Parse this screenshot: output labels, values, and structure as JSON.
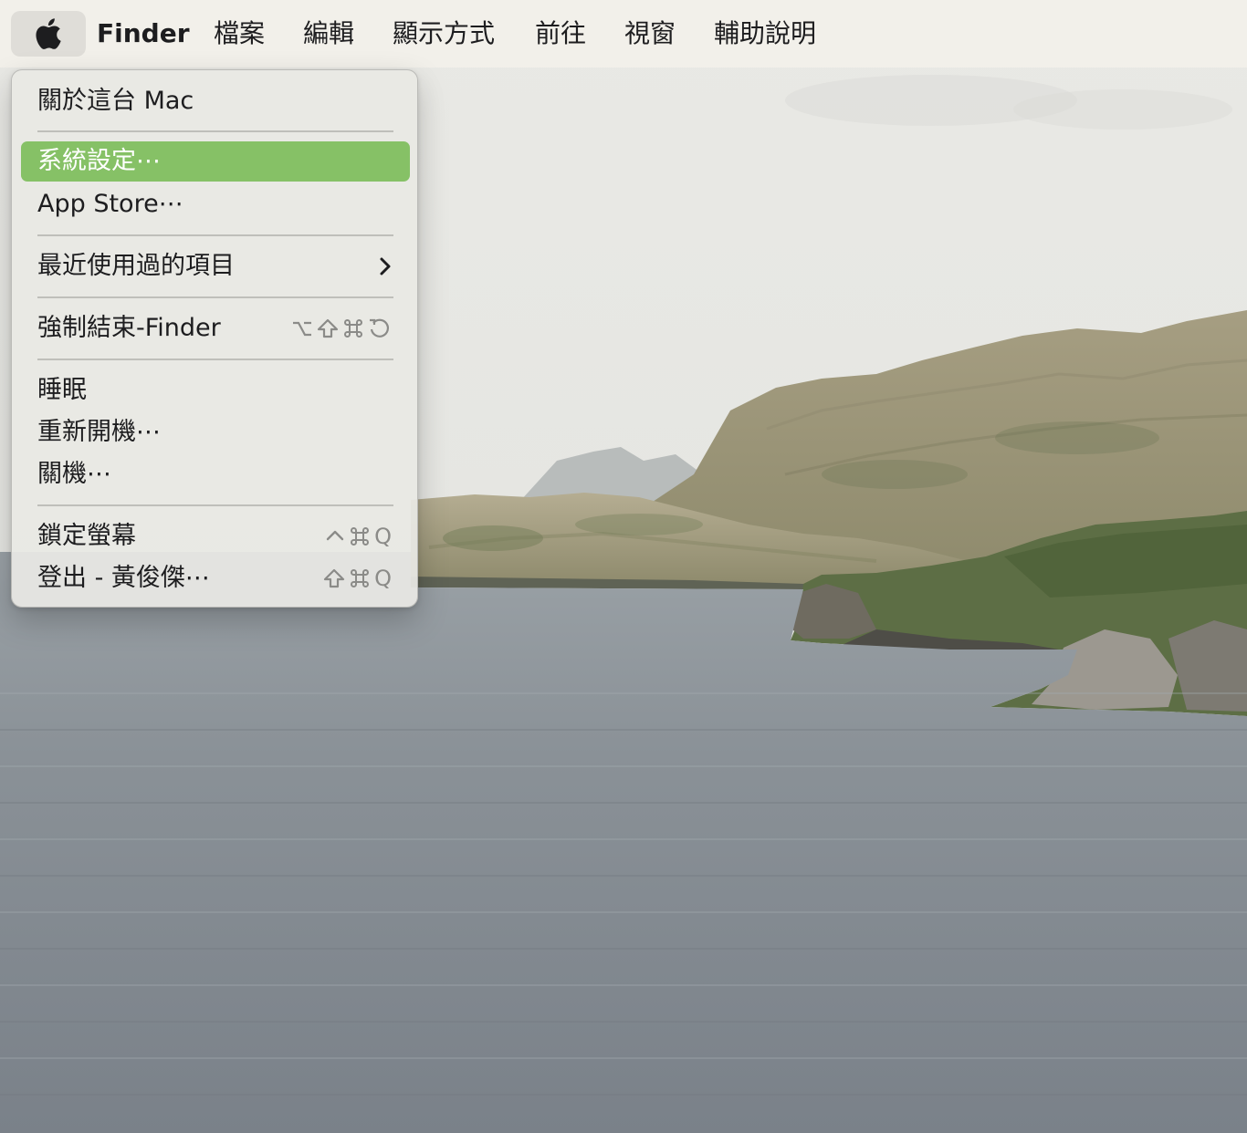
{
  "colors": {
    "menubar_bg": "#f2f0eb",
    "selection": "#86c166",
    "text": "#1d1d1f",
    "shortcut_text": "#8b8b88"
  },
  "menubar": {
    "apple_icon": "apple-logo-icon",
    "app_name": "Finder",
    "menus": [
      "檔案",
      "編輯",
      "顯示方式",
      "前往",
      "視窗",
      "輔助說明"
    ]
  },
  "apple_menu": {
    "about": "關於這台 Mac",
    "system_settings": "系統設定⋯",
    "app_store": "App Store⋯",
    "recent_items": "最近使用過的項目",
    "recent_items_icon": "chevron-right-icon",
    "force_quit": "強制結束-Finder",
    "force_quit_shortcut_icons": [
      "option-key-icon",
      "shift-key-icon",
      "command-key-icon",
      "escape-key-icon"
    ],
    "sleep": "睡眠",
    "restart": "重新開機⋯",
    "shutdown": "關機⋯",
    "lock_screen": "鎖定螢幕",
    "lock_screen_key": "Q",
    "lock_screen_shortcut_icons": [
      "control-key-icon",
      "command-key-icon"
    ],
    "logout": "登出 - 黃俊傑⋯",
    "logout_key": "Q",
    "logout_shortcut_icons": [
      "shift-key-icon",
      "command-key-icon"
    ]
  },
  "desktop": {
    "wallpaper": "coastal-hills-over-sea"
  }
}
